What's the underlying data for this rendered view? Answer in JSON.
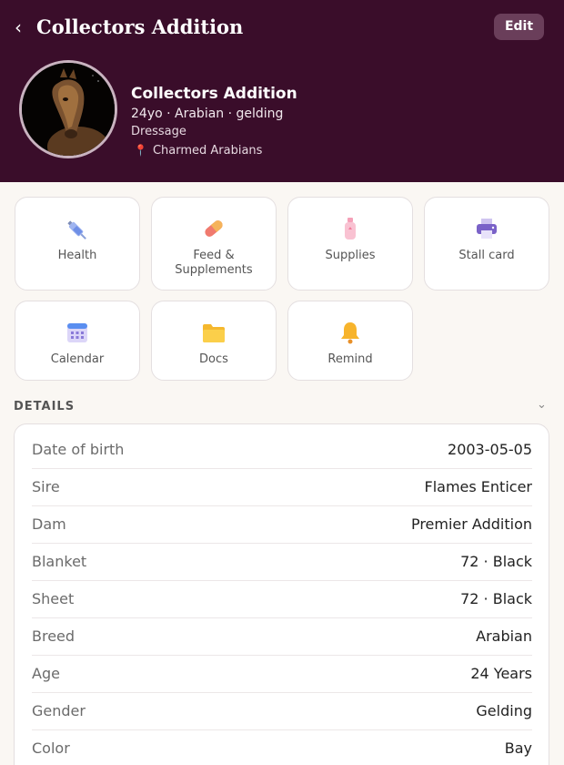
{
  "header": {
    "back_label": "‹",
    "title": "Collectors Addition",
    "edit_label": "Edit"
  },
  "profile": {
    "name": "Collectors Addition",
    "meta": "24yo · Arabian · gelding",
    "discipline": "Dressage",
    "location": "Charmed Arabians"
  },
  "actions": [
    {
      "label": "Health",
      "icon": "syringe-icon"
    },
    {
      "label": "Feed & Supplements",
      "icon": "pill-icon"
    },
    {
      "label": "Supplies",
      "icon": "bottle-icon"
    },
    {
      "label": "Stall card",
      "icon": "printer-icon"
    },
    {
      "label": "Calendar",
      "icon": "calendar-icon"
    },
    {
      "label": "Docs",
      "icon": "folder-icon"
    },
    {
      "label": "Remind",
      "icon": "bell-icon"
    }
  ],
  "details": {
    "heading": "DETAILS",
    "rows": [
      {
        "label": "Date of birth",
        "value": "2003-05-05"
      },
      {
        "label": "Sire",
        "value": "Flames Enticer"
      },
      {
        "label": "Dam",
        "value": "Premier Addition"
      },
      {
        "label": "Blanket",
        "value": "72 · Black"
      },
      {
        "label": "Sheet",
        "value": "72 · Black"
      },
      {
        "label": "Breed",
        "value": "Arabian"
      },
      {
        "label": "Age",
        "value": "24 Years"
      },
      {
        "label": "Gender",
        "value": "Gelding"
      },
      {
        "label": "Color",
        "value": "Bay"
      }
    ]
  }
}
